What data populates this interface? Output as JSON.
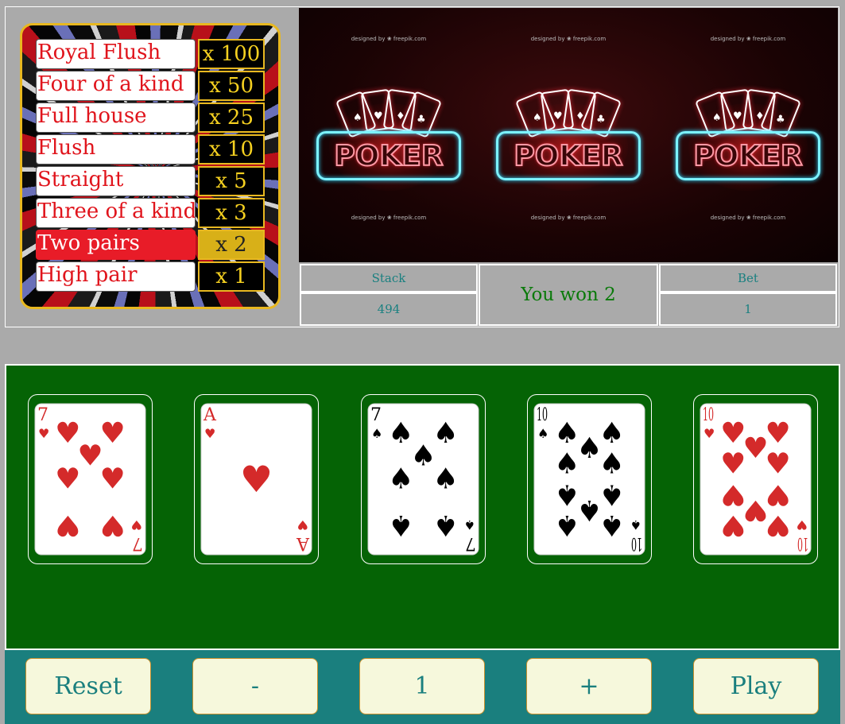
{
  "paytable": [
    {
      "hand": "Royal Flush",
      "multiplier": "x 100"
    },
    {
      "hand": "Four of a kind",
      "multiplier": "x 50"
    },
    {
      "hand": "Full house",
      "multiplier": "x 25"
    },
    {
      "hand": "Flush",
      "multiplier": "x 10"
    },
    {
      "hand": "Straight",
      "multiplier": "x 5"
    },
    {
      "hand": "Three of a kind",
      "multiplier": "x 3"
    },
    {
      "hand": "Two pairs",
      "multiplier": "x 2"
    },
    {
      "hand": "High pair",
      "multiplier": "x 1"
    }
  ],
  "highlighted_hand": "Two pairs",
  "banner": {
    "logo_text": "POKER",
    "credit_text": "designed by ❀ freepik.com",
    "repeat": 3
  },
  "info": {
    "stack_label": "Stack",
    "stack_value": "494",
    "message": "You won 2",
    "bet_label": "Bet",
    "bet_value": "1"
  },
  "hand": [
    {
      "rank": "7",
      "suit": "hearts"
    },
    {
      "rank": "A",
      "suit": "hearts"
    },
    {
      "rank": "7",
      "suit": "spades"
    },
    {
      "rank": "10",
      "suit": "spades"
    },
    {
      "rank": "10",
      "suit": "hearts"
    }
  ],
  "controls": {
    "reset": "Reset",
    "minus": "-",
    "bet_display": "1",
    "plus": "+",
    "play": "Play"
  },
  "colors": {
    "felt": "#056305",
    "control_bar": "#1a7f7e",
    "button_bg": "#f6f8dc",
    "button_text": "#1a7f7e",
    "highlight_row": "#e81c28",
    "highlight_multiplier": "#d8b018",
    "heart_red": "#d42a2a",
    "message_green": "#0a7a0a"
  }
}
